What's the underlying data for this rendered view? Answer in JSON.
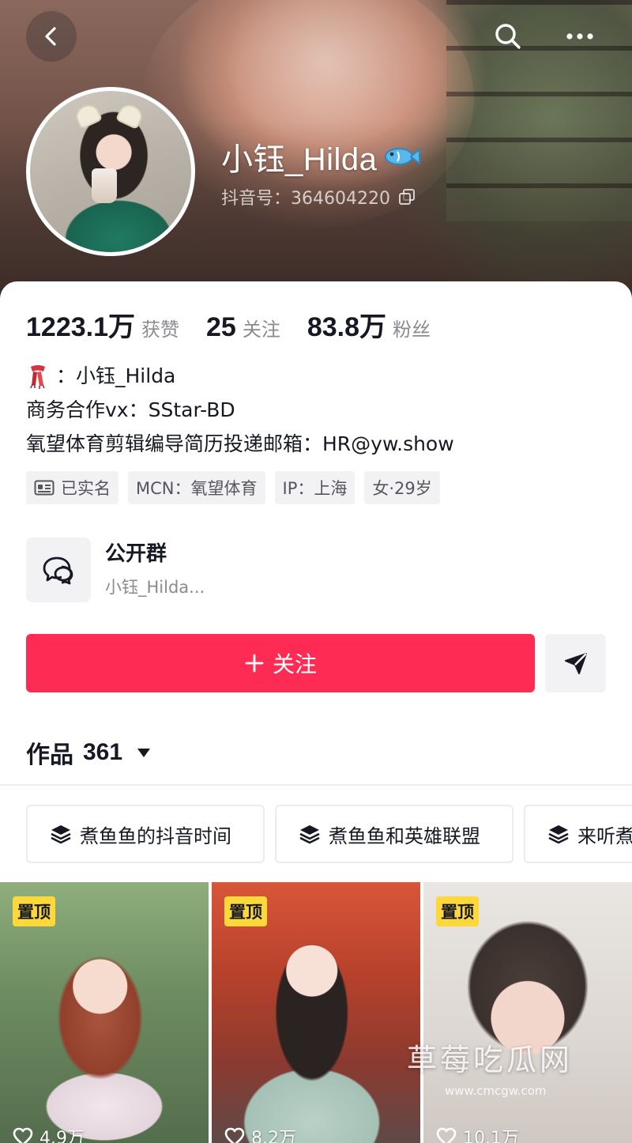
{
  "header": {
    "username": "小钰_Hilda",
    "douyin_id": "抖音号：364604220",
    "icons": [
      "back-icon",
      "search-icon",
      "more-icon",
      "fish-icon",
      "copy-icon"
    ]
  },
  "stats": [
    {
      "value": "1223.1万",
      "label": "获赞"
    },
    {
      "value": "25",
      "label": "关注"
    },
    {
      "value": "83.8万",
      "label": "粉丝"
    }
  ],
  "bio": {
    "line1": "：小钰_Hilda",
    "line2": "商务合作vx：SStar-BD",
    "line3": "氧望体育剪辑编导简历投递邮箱：HR@yw.show"
  },
  "tags": [
    {
      "label": "已实名",
      "icon": "id-card-icon"
    },
    {
      "label": "MCN：氧望体育"
    },
    {
      "label": "IP：上海"
    },
    {
      "label": "女·29岁"
    }
  ],
  "group": {
    "title": "公开群",
    "subtitle": "小钰_Hilda..."
  },
  "actions": {
    "follow_label": "关注",
    "accent_color": "#fe2c55"
  },
  "works": {
    "label": "作品",
    "count": "361"
  },
  "collections": [
    {
      "label": "煮鱼鱼的抖音时间"
    },
    {
      "label": "煮鱼鱼和英雄联盟"
    },
    {
      "label": "来听煮"
    }
  ],
  "videos": [
    {
      "badge": "置顶",
      "likes": "4.9万"
    },
    {
      "badge": "置顶",
      "likes": "8.2万"
    },
    {
      "badge": "置顶",
      "likes": "10.1万"
    }
  ],
  "watermark": {
    "title": "草莓吃瓜网",
    "url": "www.cmcgw.com"
  }
}
